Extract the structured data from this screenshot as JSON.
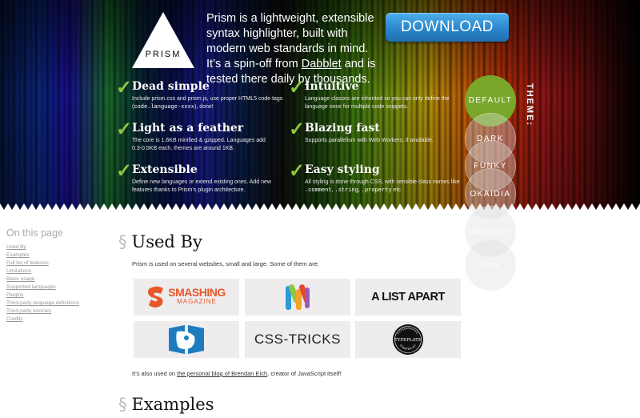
{
  "header": {
    "logo_text": "PRISM",
    "intro_before_link": "Prism is a lightweight, extensible syntax highlighter, built with modern web standards in mind. It’s a spin-off from ",
    "intro_link": "Dabblet",
    "intro_after_link": " and is tested there daily by thousands.",
    "download_label": "DOWNLOAD"
  },
  "features": [
    {
      "title": "Dead simple",
      "text_before": "Include prism.css and prism.js, use proper HTML5 code tags (",
      "code": "code.language-xxxx",
      "text_after": "), done!"
    },
    {
      "title": "Intuitive",
      "text": "Language classes are inherited so you can only define the language once for multiple code snippets."
    },
    {
      "title": "Light as a feather",
      "text": "The core is 1.6KB minified & gzipped. Languages add 0.3-0.5KB each, themes are around 1KB."
    },
    {
      "title": "Blazing fast",
      "text": "Supports parallelism with Web Workers, if available."
    },
    {
      "title": "Extensible",
      "text": "Define new languages or extend existing ones. Add new features thanks to Prism’s plugin architecture."
    },
    {
      "title": "Easy styling",
      "text_before": "All styling is done through CSS, with sensible class names like ",
      "code1": ".comment",
      "sep1": ", ",
      "code2": ".string",
      "sep2": ", ",
      "code3": ".property",
      "text_after": " etc"
    }
  ],
  "themes": {
    "label": "THEME:",
    "items": [
      "DEFAULT",
      "DARK",
      "FUNKY",
      "OKAIDIA",
      "TWILIGHT",
      "COY"
    ],
    "selected": "DEFAULT",
    "accent": "#79a72a"
  },
  "toc": {
    "title": "On this page",
    "items": [
      "Used By",
      "Examples",
      "Full list of features",
      "Limitations",
      "Basic usage",
      "Supported languages",
      "Plugins",
      "Third-party language definitions",
      "Third-party tutorials",
      "Credits"
    ]
  },
  "used_by": {
    "sign": "§",
    "title": "Used By",
    "intro": "Prism is used on several websites, small and large. Some of them are:",
    "logos": [
      {
        "name": "Smashing Magazine",
        "line1": "SMASHING",
        "line2": "MAGAZINE"
      },
      {
        "name": "Webplatform",
        "text": ""
      },
      {
        "name": "A List Apart",
        "text": "A LIST APART"
      },
      {
        "name": "Drupal",
        "text": ""
      },
      {
        "name": "CSS-Tricks",
        "text": "CSS-TRICKS"
      },
      {
        "name": "Typeplate",
        "text": "TYPEPLATE",
        "ring_top": "TYPOGRAPHIC",
        "ring_bottom": "STARTER KIT"
      }
    ],
    "outro_before": "It’s also used on ",
    "outro_link": "the personal blog of Brendan Eich",
    "outro_after": ", creator of JavaScript itself!"
  },
  "examples": {
    "sign": "§",
    "title": "Examples"
  }
}
